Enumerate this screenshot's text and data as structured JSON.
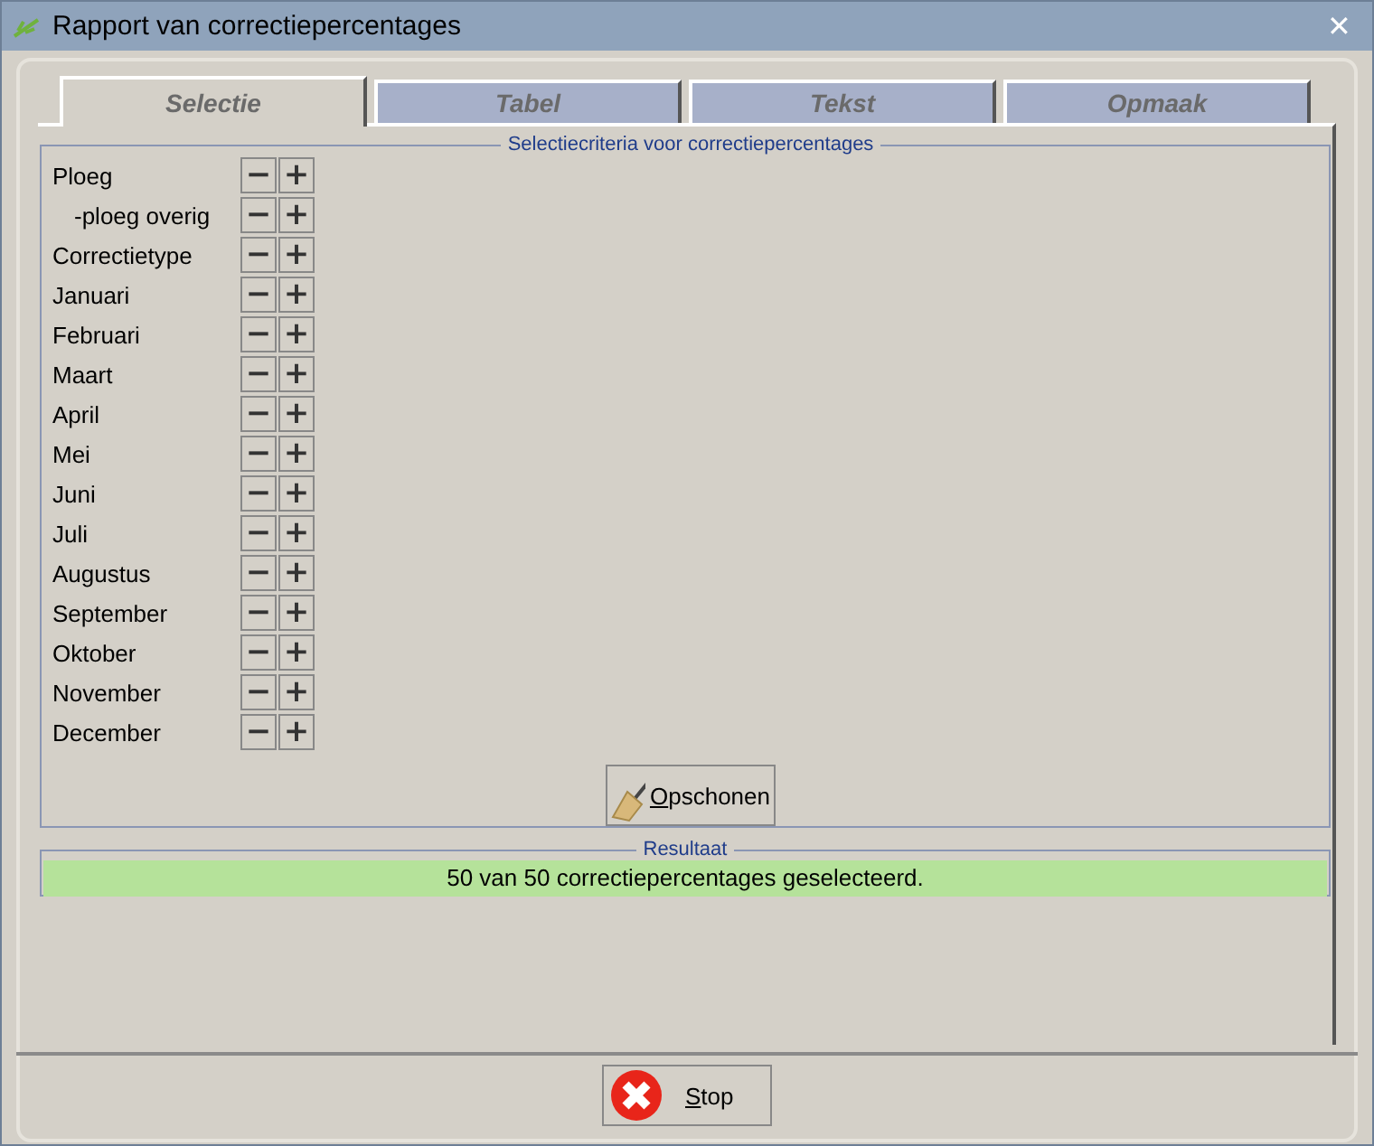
{
  "window": {
    "title": "Rapport van correctiepercentages",
    "close": "✕"
  },
  "tabs": [
    {
      "label": "Selectie",
      "selected": true
    },
    {
      "label": "Tabel",
      "selected": false
    },
    {
      "label": "Tekst",
      "selected": false
    },
    {
      "label": "Opmaak",
      "selected": false
    }
  ],
  "criteria": {
    "title": "Selectiecriteria voor correctiepercentages",
    "rows": [
      {
        "label": "Ploeg",
        "children": [
          {
            "label": "-ploeg overig"
          }
        ]
      },
      {
        "label": "Correctietype"
      },
      {
        "label": "Januari"
      },
      {
        "label": "Februari"
      },
      {
        "label": "Maart"
      },
      {
        "label": "April"
      },
      {
        "label": "Mei"
      },
      {
        "label": "Juni"
      },
      {
        "label": "Juli"
      },
      {
        "label": "Augustus"
      },
      {
        "label": "September"
      },
      {
        "label": "Oktober"
      },
      {
        "label": "November"
      },
      {
        "label": "December"
      }
    ],
    "minus": "−",
    "plus": "+",
    "clear_button": {
      "mnemonic": "O",
      "rest": "pschonen"
    }
  },
  "result": {
    "title": "Resultaat",
    "message": "50 van 50 correctiepercentages geselecteerd."
  },
  "stop_button": {
    "mnemonic": "S",
    "rest": "top"
  }
}
